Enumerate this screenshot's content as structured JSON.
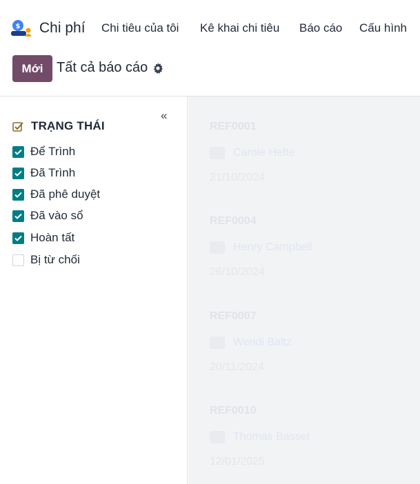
{
  "app": {
    "name": "Chi phí",
    "icon": "expenses-app-icon"
  },
  "menu": [
    "Chi tiêu của tôi",
    "Kê khai chi tiêu",
    "Báo cáo",
    "Cấu hình"
  ],
  "control": {
    "new_label": "Mới",
    "breadcrumb": "Tất cả báo cáo",
    "settings_icon": "gear-icon"
  },
  "sidebar": {
    "collapse_icon": "«",
    "section_title": "TRẠNG THÁI",
    "filters": [
      {
        "label": "Để Trình",
        "checked": true
      },
      {
        "label": "Đã Trình",
        "checked": true
      },
      {
        "label": "Đã phê duyệt",
        "checked": true
      },
      {
        "label": "Đã vào sổ",
        "checked": true
      },
      {
        "label": "Hoàn tất",
        "checked": true
      },
      {
        "label": "Bị từ chối",
        "checked": false
      }
    ]
  },
  "records": [
    {
      "ref": "REF0001",
      "employee": "Carole Hefte",
      "date": "21/10/2024"
    },
    {
      "ref": "REF0004",
      "employee": "Henry Campbell",
      "date": "26/10/2024"
    },
    {
      "ref": "REF0007",
      "employee": "Wendi Baltz",
      "date": "20/11/2024"
    },
    {
      "ref": "REF0010",
      "employee": "Thomas Basset",
      "date": "12/01/2025"
    }
  ],
  "colors": {
    "accent": "#714b67",
    "checkbox": "#017e84"
  }
}
